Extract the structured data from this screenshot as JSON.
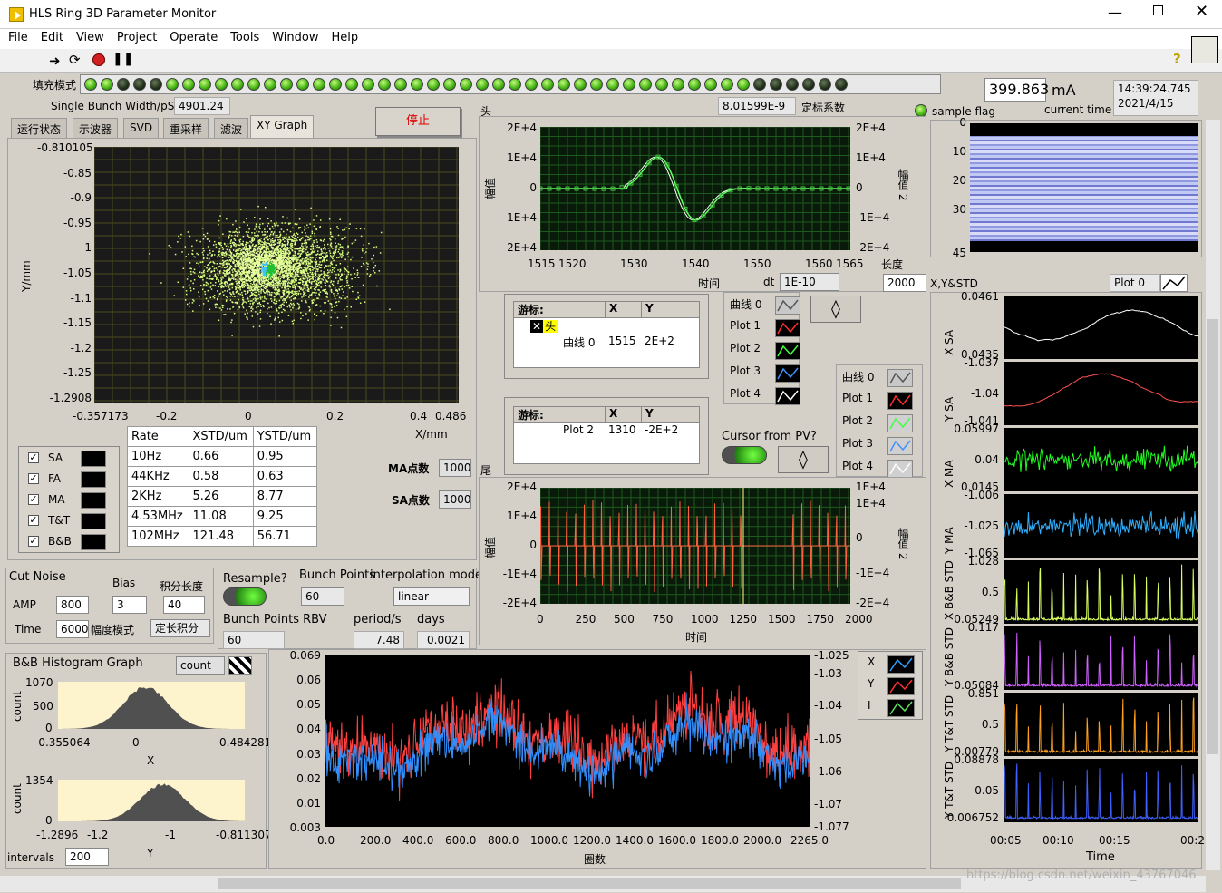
{
  "window": {
    "title": "HLS Ring 3D Parameter Monitor"
  },
  "menu": [
    "File",
    "Edit",
    "View",
    "Project",
    "Operate",
    "Tools",
    "Window",
    "Help"
  ],
  "fill_mode": {
    "label": "填充模式",
    "leds": [
      1,
      1,
      0,
      0,
      0,
      1,
      1,
      1,
      1,
      1,
      1,
      1,
      1,
      1,
      1,
      1,
      1,
      1,
      1,
      1,
      1,
      1,
      1,
      1,
      1,
      1,
      1,
      1,
      1,
      1,
      1,
      1,
      1,
      1,
      1,
      1,
      1,
      1,
      1,
      1,
      1,
      0,
      0,
      0,
      0,
      0,
      0
    ]
  },
  "bunch_width": {
    "label": "Single Bunch Width/pS",
    "value": "4901.24"
  },
  "stop_button": "停止",
  "tabs": [
    "运行状态",
    "示波器",
    "SVD",
    "重采样",
    "滤波",
    "XY Graph"
  ],
  "calib": {
    "value": "8.01599E-9",
    "label": "定标系数"
  },
  "current": {
    "value": "399.863",
    "unit": "mA",
    "time": "14:39:24.745",
    "date": "2021/4/15",
    "sample_flag": "sample flag",
    "current_time": "current time"
  },
  "xy_graph": {
    "ylabel": "Y/mm",
    "xlabel": "X/mm",
    "yticks": [
      "-0.810105",
      "-0.85",
      "-0.9",
      "-0.95",
      "-1",
      "-1.05",
      "-1.1",
      "-1.15",
      "-1.2",
      "-1.25",
      "-1.2908"
    ],
    "xticks": [
      "-0.357173",
      "-0.2",
      "0",
      "0.2",
      "0.4",
      "0.486"
    ]
  },
  "legend_rows": [
    "SA",
    "FA",
    "MA",
    "T&T",
    "B&B"
  ],
  "rate_table": {
    "headers": [
      "Rate",
      "XSTD/um",
      "YSTD/um"
    ],
    "rows": [
      [
        "10Hz",
        "0.66",
        "0.95"
      ],
      [
        "44KHz",
        "0.58",
        "0.63"
      ],
      [
        "2KHz",
        "5.26",
        "8.77"
      ],
      [
        "4.53MHz",
        "11.08",
        "9.25"
      ],
      [
        "102MHz",
        "121.48",
        "56.71"
      ]
    ]
  },
  "ma_points": {
    "label": "MA点数",
    "value": "1000"
  },
  "sa_points": {
    "label": "SA点数",
    "value": "1000"
  },
  "cut_noise": {
    "label": "Cut Noise",
    "amp_label": "AMP",
    "amp": "800",
    "time_label": "Time",
    "time": "6000",
    "bias_label": "Bias",
    "bias": "3",
    "int_label": "积分长度",
    "int_val": "40",
    "amp_mode_label": "幅度模式",
    "amp_mode": "定长积分"
  },
  "resample": {
    "label": "Resample?",
    "bunch_label": "Bunch Points",
    "bunch": "60",
    "interp_label": "interpolation mode",
    "interp": "linear",
    "rbv_label": "Bunch Points RBV",
    "rbv": "60",
    "period_label": "period/s",
    "period": "7.48",
    "days_label": "days",
    "days": "0.0021"
  },
  "head_graph": {
    "title": "头",
    "xlabel": "时间",
    "ylabel": "幅值",
    "ylabel2": "幅值 2",
    "yticks": [
      "2E+4",
      "1E+4",
      "0",
      "-1E+4",
      "-2E+4"
    ],
    "xticks": [
      "1515",
      "1520",
      "1530",
      "1540",
      "1550",
      "1560",
      "1565"
    ],
    "dt_label": "dt",
    "dt": "1E-10",
    "len_label": "长度",
    "len": "2000"
  },
  "cursor1": {
    "title": "游标:",
    "col_x": "X",
    "col_y": "Y",
    "item": "头",
    "sub": "曲线 0",
    "x": "1515",
    "y": "2E+2"
  },
  "cursor2": {
    "title": "游标:",
    "col_x": "X",
    "col_y": "Y",
    "sub": "Plot 2",
    "x": "1310",
    "y": "-2E+2"
  },
  "plot_legend1": [
    "曲线 0",
    "Plot 1",
    "Plot 2",
    "Plot 3",
    "Plot 4"
  ],
  "plot_legend2": [
    "曲线 0",
    "Plot 1",
    "Plot 2",
    "Plot 3",
    "Plot 4"
  ],
  "cursor_pv": "Cursor from PV?",
  "tail_graph": {
    "title": "尾",
    "xlabel": "时间",
    "ylabel": "幅值",
    "ylabel2": "幅值 2",
    "yticks": [
      "2E+4",
      "1E+4",
      "0",
      "-1E+4",
      "-2E+4"
    ],
    "y2ticks": [
      "1E+4",
      "1E+4",
      "0",
      "-1E+4",
      "-2E+4"
    ],
    "xticks": [
      "0",
      "250",
      "500",
      "750",
      "1000",
      "1250",
      "1500",
      "1750",
      "2000"
    ]
  },
  "spectro": {
    "yticks": [
      "0",
      "10",
      "20",
      "30",
      "45"
    ]
  },
  "xy_std": {
    "title": "X,Y&STD",
    "plot_label": "Plot 0",
    "panels": [
      {
        "label": "X SA",
        "top": "0.0461",
        "bot": "0.0435",
        "mid": "",
        "color": "#ffffff"
      },
      {
        "label": "Y SA",
        "top": "-1.037",
        "bot": "-1.041",
        "mid": "-1.04",
        "color": "#ff5050"
      },
      {
        "label": "X MA",
        "top": "0.05997",
        "bot": "0.0145",
        "mid": "0.04",
        "color": "#20ff20"
      },
      {
        "label": "Y MA",
        "top": "-1.006",
        "bot": "-1.065",
        "mid": "-1.025",
        "color": "#30b0ff"
      },
      {
        "label": "X B&B STD",
        "top": "1.028",
        "bot": "0.05249",
        "mid": "0.5",
        "color": "#d8ff60"
      },
      {
        "label": "Y B&B STD",
        "top": "0.117",
        "bot": "0.05084",
        "mid": "",
        "color": "#d060ff"
      },
      {
        "label": "Y T&T STD",
        "top": "0.851",
        "bot": "0.00779",
        "mid": "0.5",
        "color": "#ffa020"
      },
      {
        "label": "Y T&T STD",
        "top": "0.08878",
        "bot": "0.006752",
        "mid": "0.05",
        "color": "#4060ff"
      }
    ],
    "xticks": [
      "00:05",
      "00:10",
      "00:15",
      "00:2"
    ],
    "xlabel": "Time"
  },
  "hist": {
    "title": "B&B Histogram Graph",
    "count_label": "count",
    "h1": {
      "ylabel": "count",
      "ytop": "1070",
      "ymid": "500",
      "ybot": "0",
      "xl": "-0.355064",
      "xm": "0",
      "xr": "0.484281",
      "xlabel": "X"
    },
    "h2": {
      "ylabel": "count",
      "ytop": "1354",
      "ybot": "0",
      "xl": "-1.2896",
      "xm1": "-1.2",
      "xm2": "-1",
      "xr": "-0.811307",
      "xlabel": "Y"
    },
    "intervals_label": "intervals",
    "intervals": "200"
  },
  "ring_graph": {
    "xlabel": "圈数",
    "yticks": [
      "0.069",
      "0.06",
      "0.05",
      "0.04",
      "0.03",
      "0.02",
      "0.01",
      "0.003"
    ],
    "y2ticks": [
      "-1.025",
      "-1.03",
      "-1.04",
      "-1.05",
      "-1.06",
      "-1.07",
      "-1.077"
    ],
    "xticks": [
      "0.0",
      "200.0",
      "400.0",
      "600.0",
      "800.0",
      "1000.0",
      "1200.0",
      "1400.0",
      "1600.0",
      "1800.0",
      "2000.0",
      "2265.0"
    ],
    "legend": [
      "X",
      "Y",
      "I"
    ]
  },
  "watermark": "https://blog.csdn.net/weixin_43767046"
}
